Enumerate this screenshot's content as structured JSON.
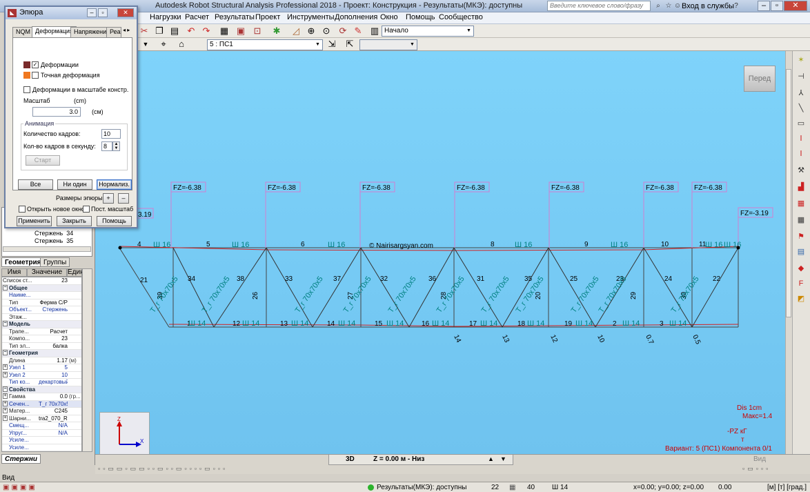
{
  "app": {
    "title": "Autodesk Robot Structural Analysis Professional 2018 - Проект: Конструкция - Результаты(МКЭ): доступны",
    "help_search_placeholder": "Введите ключевое слово/фразу",
    "login_label": "Вход в службы"
  },
  "menu": [
    "Нагрузки",
    "Расчет",
    "Результаты",
    "Проект",
    "Инструменты",
    "Дополнения",
    "Окно",
    "Помощь",
    "Сообщество"
  ],
  "toolbar": {
    "layout_combo": "Начало",
    "load_case_combo": "5 : ПС1"
  },
  "dialog": {
    "title": "Эпюра",
    "tabs": [
      "NQM",
      "Деформация",
      "Напряжения",
      "Реа"
    ],
    "active_tab": "Деформация",
    "deformations_label": "Деформации",
    "deformations_checked": "✓",
    "exact_deformation_label": "Точная  деформация",
    "scaled_label": "Деформации в масштабе констр.",
    "scale_label": "Масштаб",
    "scale_unit_top": "(cm)",
    "scale_value": "3.0",
    "scale_unit": "(см)",
    "animation_group": "Анимация",
    "frames_label": "Количество кадров:",
    "frames_value": "10",
    "fps_label": "Кол-во кадров в секунду:",
    "fps_value": "8",
    "start_button": "Старт",
    "all_button": "Все",
    "none_button": "Ни один",
    "normalize_button": "Нормализ.",
    "size_label": "Размеры эпюры:",
    "plus": "+",
    "minus": "–",
    "new_window_label": "Открыть новое окно",
    "const_scale_label": "Пост. масштаб",
    "apply_button": "Применить",
    "close_button": "Закрыть",
    "help_button": "Помощь",
    "colors": {
      "deformation": "#7a2b2b",
      "exact": "#f07820"
    }
  },
  "tree": {
    "rows": [
      {
        "label": "Стержень",
        "num": "34"
      },
      {
        "label": "Стержень",
        "num": "35"
      }
    ]
  },
  "left_tabs": [
    "Геометрия",
    "Группы"
  ],
  "props": {
    "headers": [
      "Имя",
      "Значение",
      "Един"
    ],
    "rows": [
      {
        "name": "Список ст...",
        "value": "23",
        "unit": "",
        "kind": "top"
      },
      {
        "name": "Общее",
        "kind": "sec",
        "exp": "⊟"
      },
      {
        "name": "Наиме...",
        "value": "",
        "unit": "",
        "kind": "blue"
      },
      {
        "name": "Тип",
        "value": "Ферма С/Р",
        "unit": ""
      },
      {
        "name": "Объект...",
        "value": "Стержень",
        "unit": "",
        "kind": "blue"
      },
      {
        "name": "Этаж...",
        "value": "",
        "unit": ""
      },
      {
        "name": "Модель",
        "kind": "sec",
        "exp": "⊟"
      },
      {
        "name": "Трапе...",
        "value": "Расчет",
        "unit": ""
      },
      {
        "name": "Компо...",
        "value": "23",
        "unit": ""
      },
      {
        "name": "Тип эл...",
        "value": "балка",
        "unit": ""
      },
      {
        "name": "Геометрия",
        "kind": "sec",
        "exp": "⊟"
      },
      {
        "name": "Длина",
        "value": "1.17",
        "unit": "(м)"
      },
      {
        "name": "Узел 1",
        "value": "5",
        "unit": "",
        "kind": "blue",
        "exp": "⊞"
      },
      {
        "name": "Узел 2",
        "value": "10",
        "unit": "",
        "kind": "blue",
        "exp": "⊞"
      },
      {
        "name": "Тип ко...",
        "value": "декартовый",
        "unit": "",
        "kind": "blue"
      },
      {
        "name": "Свойства",
        "kind": "sec",
        "exp": "⊟"
      },
      {
        "name": "Гамма",
        "value": "0.0",
        "unit": "(гр...",
        "exp": "⊞"
      },
      {
        "name": "Сечен...",
        "value": "Т_г 70x70x5",
        "unit": "",
        "kind": "blue hl",
        "exp": "⊞"
      },
      {
        "name": "Матер...",
        "value": "C245",
        "unit": "",
        "exp": "⊞"
      },
      {
        "name": "Шарни...",
        "value": "tra2_070_RE",
        "unit": "",
        "exp": "⊞"
      },
      {
        "name": "Смещ...",
        "value": "N/A",
        "unit": "",
        "kind": "blue"
      },
      {
        "name": "Упруг...",
        "value": "N/A",
        "unit": "",
        "kind": "blue"
      },
      {
        "name": "Усиле...",
        "value": "",
        "unit": "",
        "kind": "blue"
      },
      {
        "name": "Усиле...",
        "value": "",
        "unit": "",
        "kind": "blue"
      }
    ]
  },
  "bottom_left_tab": "Стержни",
  "vid_label": "Вид",
  "canvas": {
    "view_cube": "Перед",
    "watermark": "© Nairisargsyan.com",
    "view_mode": "3D",
    "z_level": "Z = 0.00 м - Низ",
    "vid_button": "Вид",
    "legend": {
      "dis_line": "Dis  1cm",
      "max_line": "Макс=1.4",
      "pz_line": "-PZ  кГ",
      "t_line": "т",
      "variant_line": "Вариант: 5 (ПС1) Компонента 0/1"
    },
    "loads": [
      "FZ=-6.38",
      "FZ=-6.38",
      "FZ=-6.38",
      "FZ=-6.38",
      "FZ=-6.38",
      "FZ=-6.38",
      "FZ=-6.38",
      "FZ=-3.19"
    ],
    "left_load": "3.19",
    "top_chord_bars": [
      "4",
      "5",
      "6",
      "8",
      "9",
      "10",
      "11"
    ],
    "bottom_chord_bars": [
      "1",
      "12",
      "13",
      "14",
      "15",
      "16",
      "17",
      "18",
      "19",
      "2",
      "3"
    ],
    "diagonals": [
      "21",
      "34",
      "38",
      "33",
      "37",
      "32",
      "36",
      "31",
      "35",
      "25",
      "23",
      "24",
      "22"
    ],
    "verticals": [
      "39",
      "26",
      "27",
      "28",
      "20",
      "29",
      "30"
    ],
    "section_top": "Ш 16",
    "section_bottom": "Ш 14",
    "section_diag": "Т_г 70x70x5",
    "bottom_nodes": [
      "14",
      "13",
      "12",
      "10",
      "0.7",
      "0.5"
    ]
  },
  "status": {
    "results": "Результаты(МКЭ): доступны",
    "v1": "22",
    "v2": "40",
    "section": "Ш 14",
    "coords": "x=0.00; y=0.00; z=0.00",
    "zero": "0.00",
    "units": "[м] [т] [град.]"
  }
}
